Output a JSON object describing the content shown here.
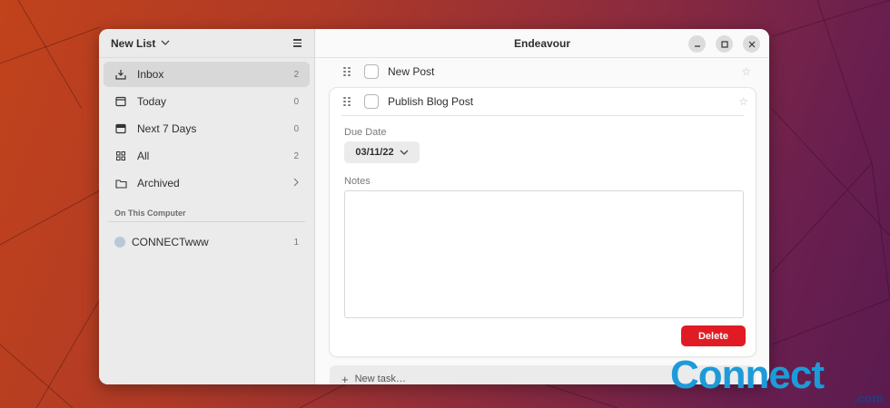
{
  "sidebar": {
    "list_switch_label": "New List",
    "items": [
      {
        "label": "Inbox",
        "count": "2",
        "icon": "inbox-icon"
      },
      {
        "label": "Today",
        "count": "0",
        "icon": "calendar-today-icon"
      },
      {
        "label": "Next 7 Days",
        "count": "0",
        "icon": "calendar-week-icon"
      },
      {
        "label": "All",
        "count": "2",
        "icon": "grid-icon"
      },
      {
        "label": "Archived",
        "count": "",
        "icon": "folder-icon"
      }
    ],
    "section_title": "On This Computer",
    "sources": [
      {
        "label": "CONNECTwww",
        "count": "1",
        "color": "#b9c8d6"
      }
    ]
  },
  "window": {
    "title": "Endeavour"
  },
  "tasks": [
    {
      "title": "New Post"
    },
    {
      "title": "Publish Blog Post"
    }
  ],
  "task_detail": {
    "due_date_label": "Due Date",
    "due_date_value": "03/11/22",
    "notes_label": "Notes",
    "notes_value": "",
    "delete_label": "Delete"
  },
  "new_task": {
    "placeholder": "New task…"
  },
  "watermark": {
    "text": "Connect",
    "suffix": ".com"
  },
  "colors": {
    "accent_destructive": "#e01b24",
    "sidebar_bg": "#ebebeb",
    "window_bg": "#fafafa",
    "wallpaper_start": "#c1431c",
    "wallpaper_end": "#5a1b4f"
  }
}
